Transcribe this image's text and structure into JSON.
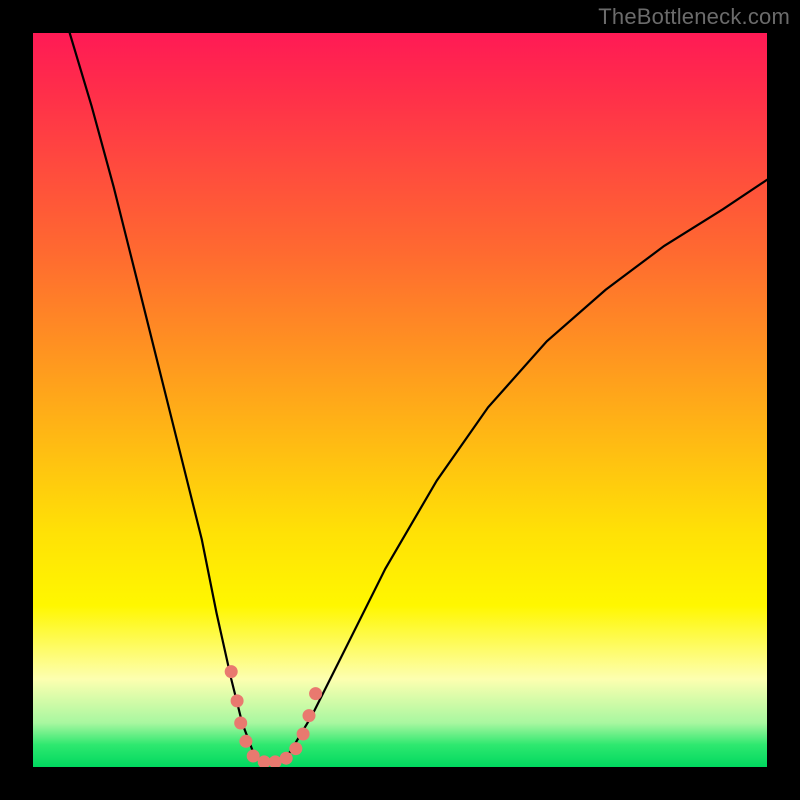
{
  "watermark": "TheBottleneck.com",
  "chart_data": {
    "type": "line",
    "title": "",
    "xlabel": "",
    "ylabel": "",
    "xlim": [
      0,
      100
    ],
    "ylim": [
      0,
      100
    ],
    "grid": false,
    "legend": false,
    "background": {
      "type": "vertical-gradient",
      "stops": [
        {
          "pos": 0.0,
          "color": "#ff1a55"
        },
        {
          "pos": 0.18,
          "color": "#ff4a3e"
        },
        {
          "pos": 0.42,
          "color": "#ff8f22"
        },
        {
          "pos": 0.68,
          "color": "#ffe106"
        },
        {
          "pos": 0.88,
          "color": "#fdffb0"
        },
        {
          "pos": 0.97,
          "color": "#2ee86f"
        },
        {
          "pos": 1.0,
          "color": "#00d85f"
        }
      ]
    },
    "series": [
      {
        "name": "bottleneck-curve",
        "color": "#000000",
        "x": [
          5,
          8,
          11,
          14,
          17,
          20,
          23,
          25,
          27,
          28.5,
          30,
          31.5,
          33,
          35,
          38,
          42,
          48,
          55,
          62,
          70,
          78,
          86,
          94,
          100
        ],
        "y": [
          100,
          90,
          79,
          67,
          55,
          43,
          31,
          21,
          12,
          6,
          2,
          0.5,
          0.5,
          2,
          7,
          15,
          27,
          39,
          49,
          58,
          65,
          71,
          76,
          80
        ]
      }
    ],
    "markers": [
      {
        "name": "dot-cluster",
        "color": "#e9796f",
        "shape": "circle",
        "size": 13,
        "points": [
          {
            "x": 27.0,
            "y": 13.0
          },
          {
            "x": 27.8,
            "y": 9.0
          },
          {
            "x": 28.3,
            "y": 6.0
          },
          {
            "x": 29.0,
            "y": 3.5
          },
          {
            "x": 30.0,
            "y": 1.5
          },
          {
            "x": 31.5,
            "y": 0.7
          },
          {
            "x": 33.0,
            "y": 0.7
          },
          {
            "x": 34.5,
            "y": 1.2
          },
          {
            "x": 35.8,
            "y": 2.5
          },
          {
            "x": 36.8,
            "y": 4.5
          },
          {
            "x": 37.6,
            "y": 7.0
          },
          {
            "x": 38.5,
            "y": 10.0
          }
        ]
      }
    ]
  },
  "colors": {
    "frame": "#000000",
    "curve": "#000000",
    "dots": "#e9796f",
    "watermark": "#6b6b6b"
  }
}
